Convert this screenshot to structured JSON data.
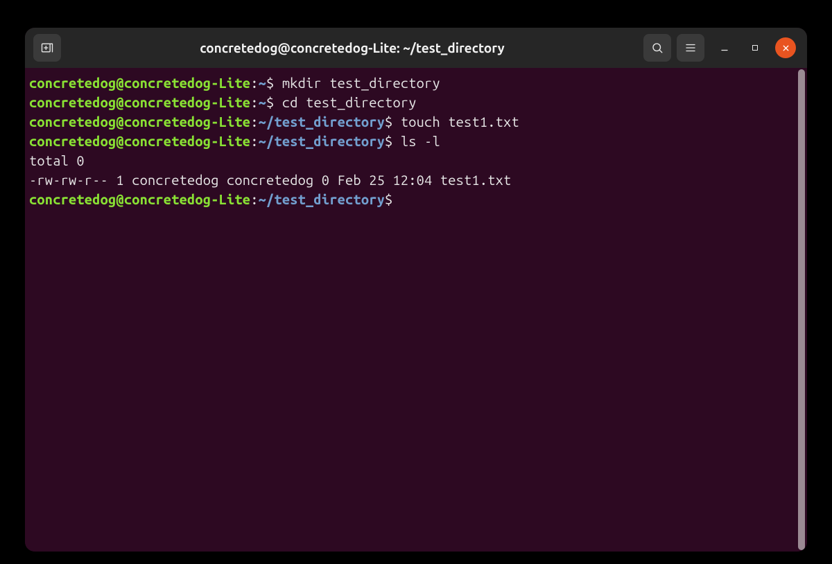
{
  "window": {
    "title": "concretedog@concretedog-Lite: ~/test_directory"
  },
  "prompt": {
    "user": "concretedog",
    "at": "@",
    "host": "concretedog-Lite",
    "sep": ":",
    "home_path": "~",
    "cwd_path": "~/test_directory",
    "symbol": "$"
  },
  "lines": {
    "l1_cmd": "mkdir test_directory",
    "l2_cmd": "cd test_directory",
    "l3_cmd": "touch test1.txt",
    "l4_cmd": "ls -l",
    "out1": "total 0",
    "out2": "-rw-rw-r-- 1 concretedog concretedog 0 Feb 25 12:04 test1.txt"
  }
}
